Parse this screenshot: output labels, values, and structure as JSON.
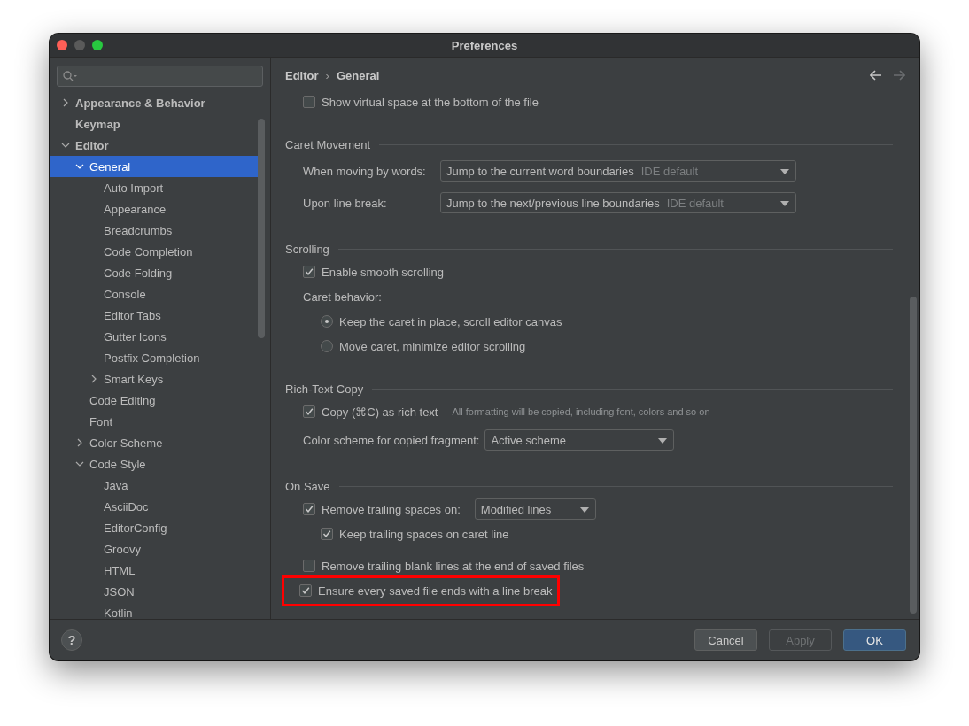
{
  "window": {
    "title": "Preferences"
  },
  "sidebar": {
    "items": [
      {
        "label": "Appearance & Behavior",
        "expanded": false,
        "selected": false
      },
      {
        "label": "Keymap",
        "selected": false
      },
      {
        "label": "Editor",
        "expanded": true,
        "selected": false,
        "children": [
          {
            "label": "General",
            "expanded": true,
            "selected": true,
            "children": [
              {
                "label": "Auto Import",
                "selected": false
              },
              {
                "label": "Appearance",
                "selected": false
              },
              {
                "label": "Breadcrumbs",
                "selected": false
              },
              {
                "label": "Code Completion",
                "selected": false
              },
              {
                "label": "Code Folding",
                "selected": false
              },
              {
                "label": "Console",
                "selected": false
              },
              {
                "label": "Editor Tabs",
                "selected": false
              },
              {
                "label": "Gutter Icons",
                "selected": false
              },
              {
                "label": "Postfix Completion",
                "selected": false
              },
              {
                "label": "Smart Keys",
                "expanded": false,
                "selected": false
              }
            ]
          },
          {
            "label": "Code Editing",
            "selected": false
          },
          {
            "label": "Font",
            "selected": false
          },
          {
            "label": "Color Scheme",
            "expanded": false,
            "selected": false
          },
          {
            "label": "Code Style",
            "expanded": true,
            "selected": false,
            "children": [
              {
                "label": "Java",
                "selected": false
              },
              {
                "label": "AsciiDoc",
                "selected": false
              },
              {
                "label": "EditorConfig",
                "selected": false
              },
              {
                "label": "Groovy",
                "selected": false
              },
              {
                "label": "HTML",
                "selected": false
              },
              {
                "label": "JSON",
                "selected": false
              },
              {
                "label": "Kotlin",
                "selected": false
              }
            ]
          }
        ]
      }
    ]
  },
  "breadcrumb": [
    "Editor",
    "General"
  ],
  "breadcrumb_separator": "›",
  "navigation": [
    {
      "kind": "back",
      "disabled": false
    },
    {
      "kind": "forward",
      "disabled": true
    }
  ],
  "sections": [
    {
      "rows": [
        {
          "kind": "checkbox",
          "label": "Show virtual space at the bottom of the file",
          "checked": false
        }
      ]
    },
    {
      "title": "Caret Movement",
      "rows": [
        {
          "kind": "dropdown",
          "label": "When moving by words:",
          "value": "Jump to the current word boundaries",
          "hint": "IDE default"
        },
        {
          "kind": "dropdown",
          "label": "Upon line break:",
          "value": "Jump to the next/previous line boundaries",
          "hint": "IDE default"
        }
      ]
    },
    {
      "title": "Scrolling",
      "rows": [
        {
          "kind": "checkbox",
          "label": "Enable smooth scrolling",
          "checked": true
        },
        {
          "kind": "label",
          "label": "Caret behavior:",
          "children": [
            {
              "kind": "radio",
              "label": "Keep the caret in place, scroll editor canvas",
              "selected": true
            },
            {
              "kind": "radio",
              "label": "Move caret, minimize editor scrolling",
              "selected": false
            }
          ]
        }
      ]
    },
    {
      "title": "Rich-Text Copy",
      "rows": [
        {
          "kind": "checkbox",
          "label": "Copy (⌘C) as rich text",
          "checked": true,
          "note": "All formatting will be copied, including font, colors and so on"
        },
        {
          "kind": "dropdown",
          "label": "Color scheme for copied fragment:",
          "value": "Active scheme"
        }
      ]
    },
    {
      "title": "On Save",
      "rows": [
        {
          "kind": "checkbox",
          "label": "Remove trailing spaces on:",
          "checked": true,
          "value": "Modified lines",
          "children": [
            {
              "kind": "checkbox",
              "label": "Keep trailing spaces on caret line",
              "checked": true
            }
          ]
        },
        {
          "kind": "checkbox",
          "label": "Remove trailing blank lines at the end of saved files",
          "checked": false
        },
        {
          "kind": "checkbox",
          "label": "Ensure every saved file ends with a line break",
          "checked": true,
          "highlighted": true
        }
      ]
    }
  ],
  "help": "?",
  "buttons": [
    {
      "label": "Cancel",
      "kind": "normal",
      "disabled": false
    },
    {
      "label": "Apply",
      "kind": "normal",
      "disabled": true
    },
    {
      "label": "OK",
      "kind": "default",
      "disabled": false
    }
  ]
}
